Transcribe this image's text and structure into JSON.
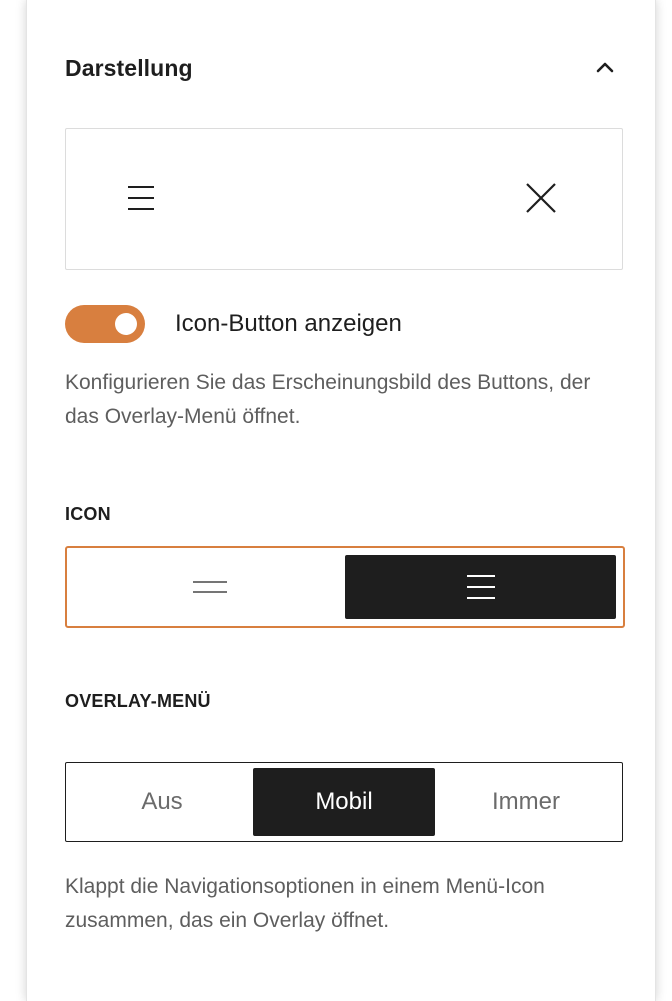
{
  "panel": {
    "title": "Darstellung",
    "collapse_icon": "chevron-up-icon"
  },
  "preview": {
    "open_icon": "menu-icon",
    "close_icon": "close-icon"
  },
  "toggle": {
    "label": "Icon-Button anzeigen",
    "checked": true,
    "accent_color": "#d87f3f"
  },
  "help_button": "Konfigurieren Sie das Erscheinungsbild des Buttons, der das Overlay-Menü öffnet.",
  "icon_section": {
    "label": "ICON",
    "options": [
      {
        "icon": "two-line-menu-icon",
        "selected": false
      },
      {
        "icon": "three-line-menu-icon",
        "selected": true
      }
    ]
  },
  "overlay_section": {
    "label": "OVERLAY-MENÜ",
    "options": [
      {
        "label": "Aus",
        "selected": false
      },
      {
        "label": "Mobil",
        "selected": true
      },
      {
        "label": "Immer",
        "selected": false
      }
    ],
    "help": "Klappt die Navigationsoptionen in einem Menü-Icon zusammen, das ein Overlay öffnet."
  }
}
